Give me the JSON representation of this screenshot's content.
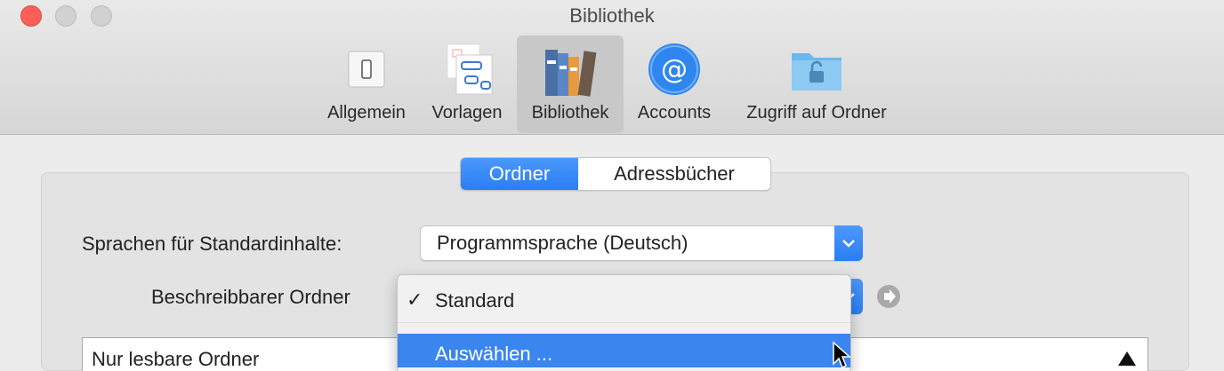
{
  "window": {
    "title": "Bibliothek"
  },
  "toolbar": {
    "items": [
      {
        "label": "Allgemein",
        "icon": "switch-icon"
      },
      {
        "label": "Vorlagen",
        "icon": "templates-icon"
      },
      {
        "label": "Bibliothek",
        "icon": "books-icon",
        "selected": true
      },
      {
        "label": "Accounts",
        "icon": "at-icon"
      },
      {
        "label": "Zugriff auf Ordner",
        "icon": "locked-folder-icon"
      }
    ]
  },
  "segmented": {
    "tabs": [
      "Ordner",
      "Adressbücher"
    ],
    "active": "Ordner"
  },
  "form": {
    "languages_label": "Sprachen für Standardinhalte:",
    "languages_value": "Programmsprache (Deutsch)",
    "writable_label": "Beschreibbarer Ordner"
  },
  "menu": {
    "items": [
      {
        "label": "Standard",
        "checked": true
      },
      {
        "label": "Auswählen ...",
        "highlighted": true
      }
    ],
    "checkmark": "✓"
  },
  "list": {
    "header": "Nur lesbare Ordner"
  },
  "colors": {
    "accent": "#2a7ef3",
    "close": "#fc5f57",
    "highlight": "#3b85ee"
  }
}
